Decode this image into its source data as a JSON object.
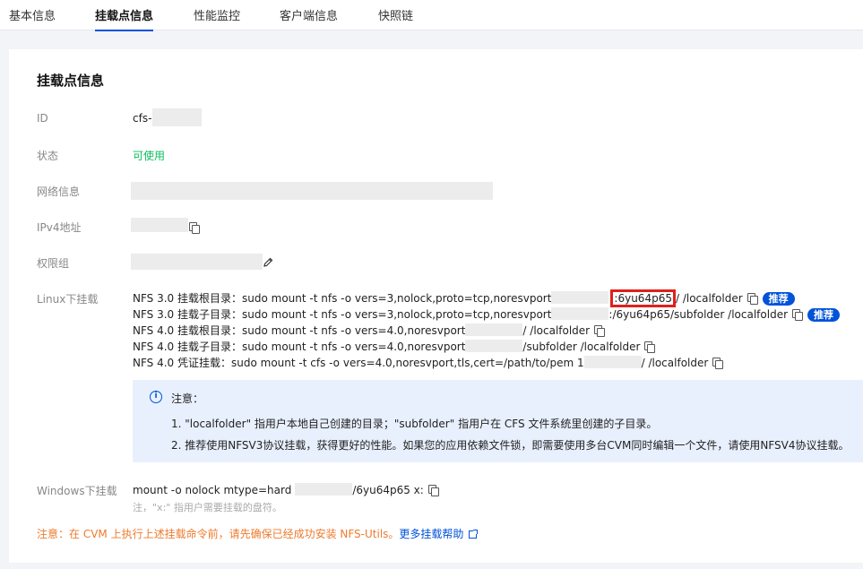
{
  "tabs": [
    "基本信息",
    "挂载点信息",
    "性能监控",
    "客户端信息",
    "快照链"
  ],
  "active_tab_index": 1,
  "card": {
    "title": "挂载点信息"
  },
  "fields": {
    "id": {
      "label": "ID",
      "value": "cfs-"
    },
    "status": {
      "label": "状态",
      "value": "可使用"
    },
    "network": {
      "label": "网络信息"
    },
    "ipv4": {
      "label": "IPv4地址"
    },
    "permission": {
      "label": "权限组"
    },
    "linux": {
      "label": "Linux下挂载"
    },
    "windows": {
      "label": "Windows下挂载"
    }
  },
  "linux_mounts": [
    {
      "prefix": "NFS 3.0 挂载根目录：sudo mount -t nfs -o vers=3,nolock,proto=tcp,noresvport",
      "highlight": ":6yu64p65",
      "suffix": "/ /localfolder",
      "badge": "推荐"
    },
    {
      "prefix": "NFS 3.0 挂载子目录：sudo mount -t nfs -o vers=3,nolock,proto=tcp,noresvport",
      "suffix": ":/6yu64p65/subfolder /localfolder",
      "badge": "推荐"
    },
    {
      "prefix": "NFS 4.0 挂载根目录：sudo mount -t nfs -o vers=4.0,noresvport",
      "suffix": "/ /localfolder"
    },
    {
      "prefix": "NFS 4.0 挂载子目录：sudo mount -t nfs -o vers=4.0,noresvport",
      "suffix": "/subfolder /localfolder"
    },
    {
      "prefix": "NFS 4.0 凭证挂载：sudo mount -t cfs -o vers=4.0,noresvport,tls,cert=/path/to/pem 1",
      "suffix": "/ /localfolder"
    }
  ],
  "notice": {
    "title": "注意：",
    "items": [
      "1. \"localfolder\" 指用户本地自己创建的目录；\"subfolder\" 指用户在 CFS 文件系统里创建的子目录。",
      "2. 推荐使用NFSV3协议挂载，获得更好的性能。如果您的应用依赖文件锁，即需要使用多台CVM同时编辑一个文件，请使用NFSV4协议挂载。"
    ]
  },
  "windows_mount": {
    "prefix": "mount -o nolock mtype=hard",
    "suffix": "/6yu64p65 x:",
    "hint": "注，\"x:\" 指用户需要挂载的盘符。"
  },
  "warning": {
    "text": "注意：在 CVM 上执行上述挂载命令前，请先确保已经成功安装 NFS-Utils。",
    "link": "更多挂载帮助"
  },
  "colors": {
    "accent": "#0052d9",
    "success": "#0abf5b",
    "warning": "#ed7b2f",
    "highlight_box": "#e0211b"
  },
  "icons": {
    "copy": "copy-icon",
    "edit": "pencil-icon",
    "info": "info-icon",
    "external": "external-link-icon"
  }
}
